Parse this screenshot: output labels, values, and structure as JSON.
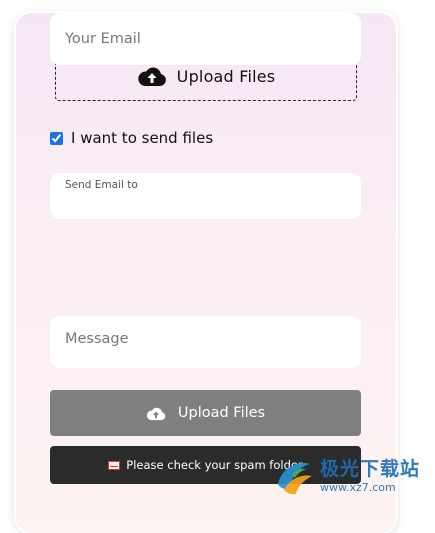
{
  "dropzone": {
    "label": "Upload Files",
    "icon": "cloud-upload-icon"
  },
  "send_files": {
    "label": "I want to send files",
    "checked": true
  },
  "send_to": {
    "label": "Send Email to",
    "value": ""
  },
  "your_email": {
    "placeholder": "Your Email",
    "value": ""
  },
  "message": {
    "placeholder": "Message",
    "value": ""
  },
  "upload_button": {
    "label": "Upload Files",
    "icon": "cloud-upload-icon"
  },
  "notice": {
    "icon": "mail-icon",
    "text": "Please check your spam folder"
  },
  "watermark": {
    "text": "极光下载站",
    "url": "www.xz7.com"
  },
  "colors": {
    "button_bg": "#7f7f7f",
    "notice_bg": "#2b2b2b",
    "card_bg": "#f7eaf3",
    "checkbox": "#1a73e8"
  }
}
